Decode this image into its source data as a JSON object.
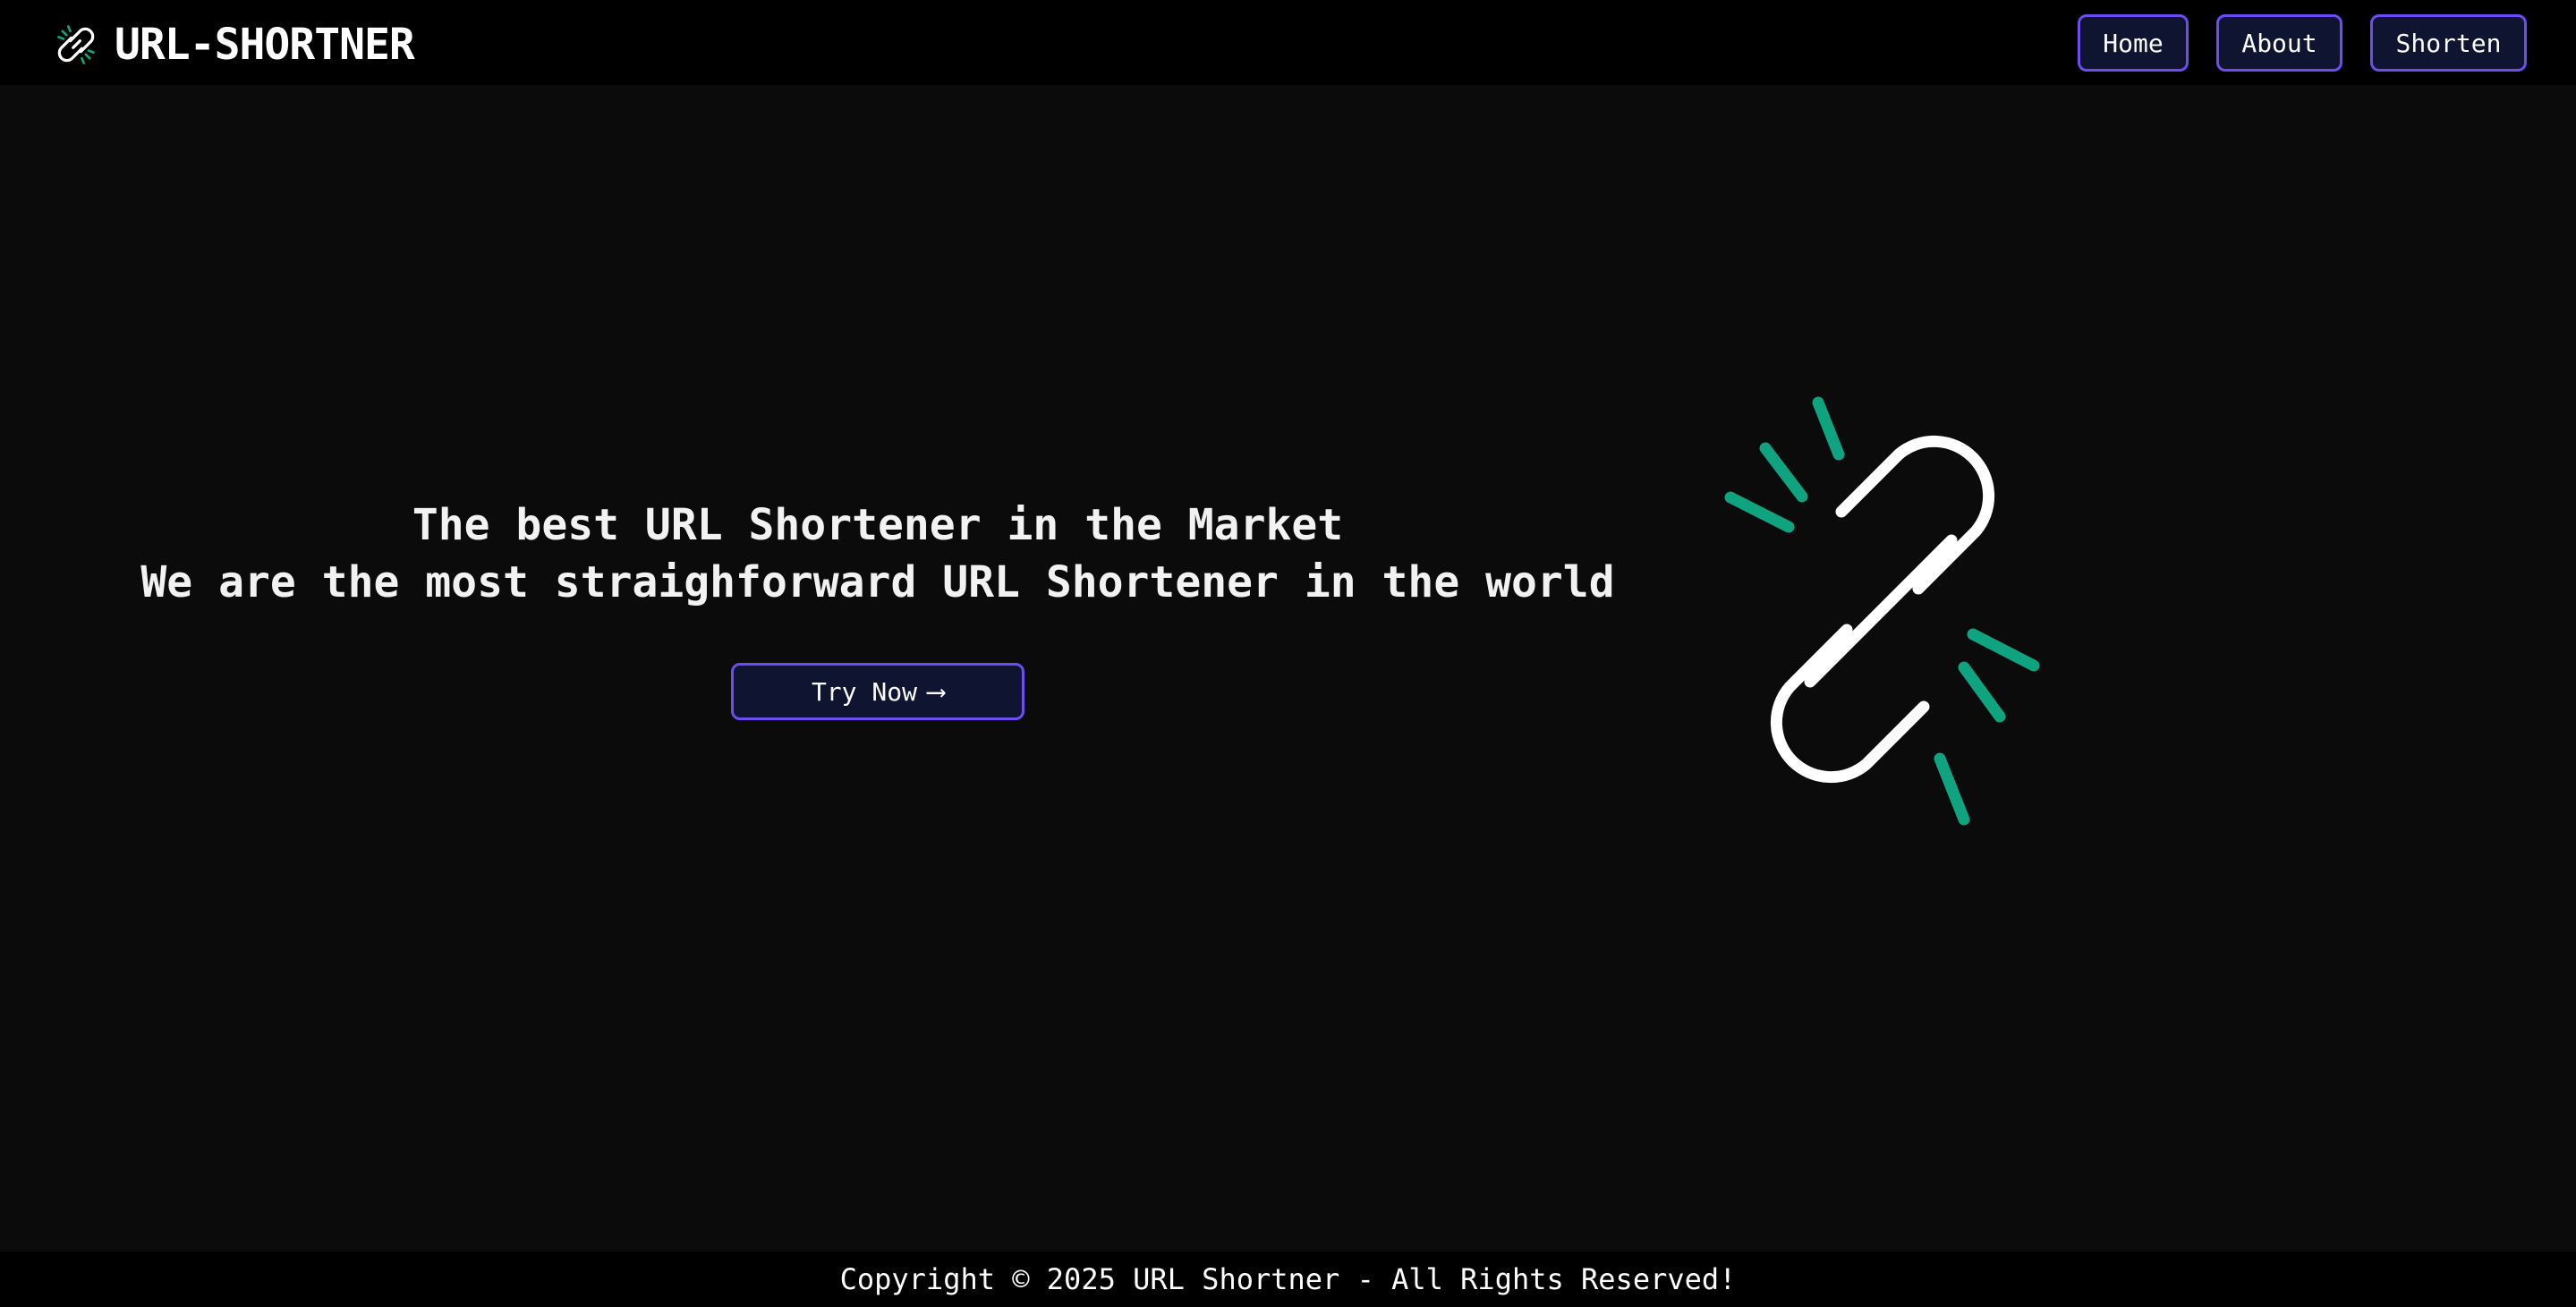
{
  "brand": {
    "title": "URL-SHORTNER",
    "icon": "broken-link-icon"
  },
  "nav": {
    "items": [
      {
        "label": "Home"
      },
      {
        "label": "About"
      },
      {
        "label": "Shorten"
      }
    ]
  },
  "hero": {
    "line1": "The best URL Shortener in the Market",
    "line2": "We are the most straighforward URL Shortener in the world",
    "cta_label": "Try Now",
    "cta_icon": "arrow-right-icon",
    "graphic_icon": "broken-link-icon"
  },
  "footer": {
    "text": "Copyright © 2025 URL Shortner - All Rights Reserved!"
  },
  "colors": {
    "page_bg": "#0b0b0b",
    "bar_bg": "#000000",
    "button_border": "#6d4cf0",
    "button_bg": "#0f1430",
    "accent_green": "#0fa37f",
    "text": "#ffffff"
  }
}
